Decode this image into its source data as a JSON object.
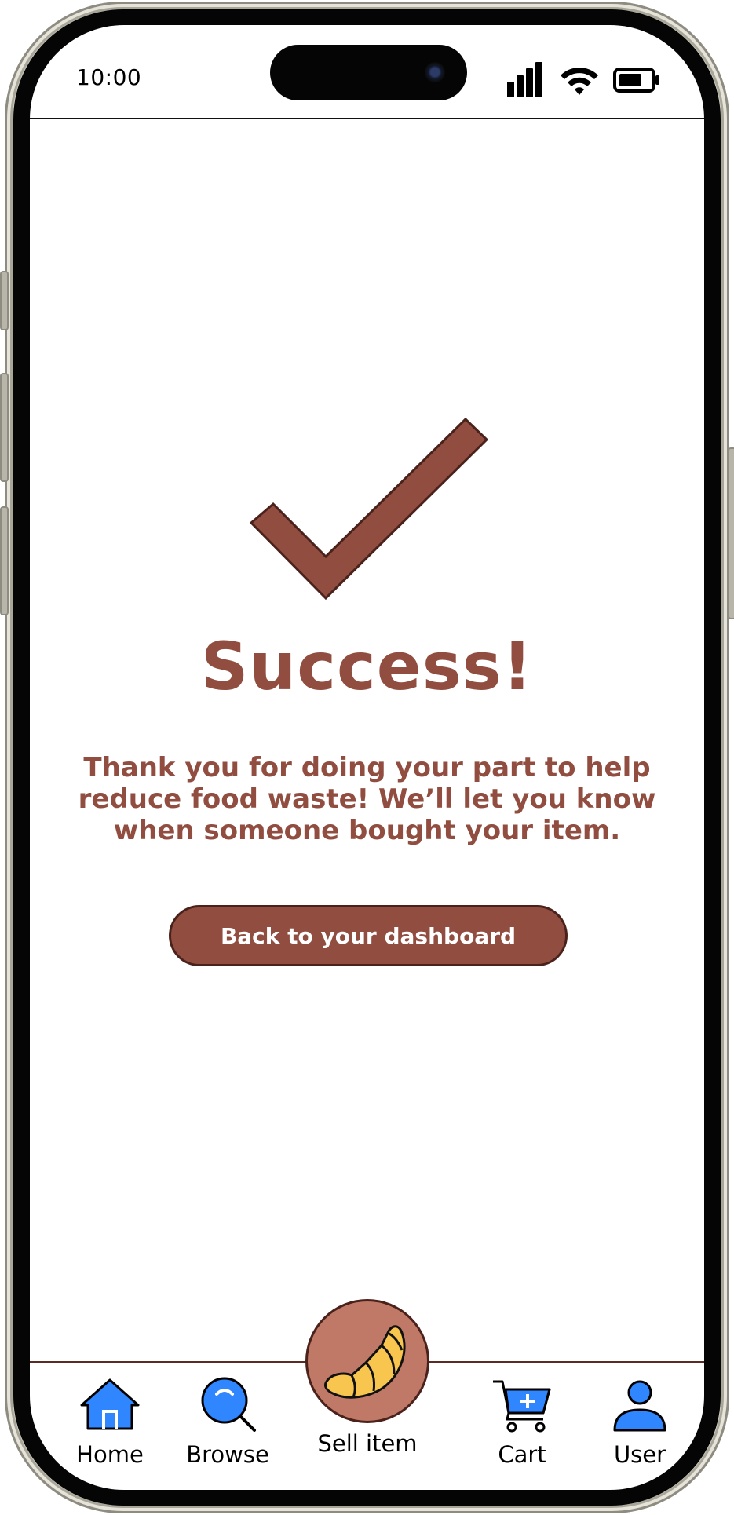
{
  "status_bar": {
    "time": "10:00"
  },
  "success": {
    "title": "Success!",
    "message": "Thank you for doing your part to help reduce food waste!  We’ll let you know when someone bought your item.",
    "button_label": "Back to your dashboard"
  },
  "tab_bar": {
    "items": [
      {
        "label": "Home",
        "icon": "house-icon"
      },
      {
        "label": "Browse",
        "icon": "search-icon"
      },
      {
        "label": "Sell item",
        "icon": "croissant-icon"
      },
      {
        "label": "Cart",
        "icon": "cart-icon"
      },
      {
        "label": "User",
        "icon": "user-icon"
      }
    ]
  },
  "colors": {
    "accent": "#914d40",
    "sell_circle": "#c07966",
    "tab_icon_blue": "#2f86ff",
    "croissant": "#f8c54f"
  }
}
